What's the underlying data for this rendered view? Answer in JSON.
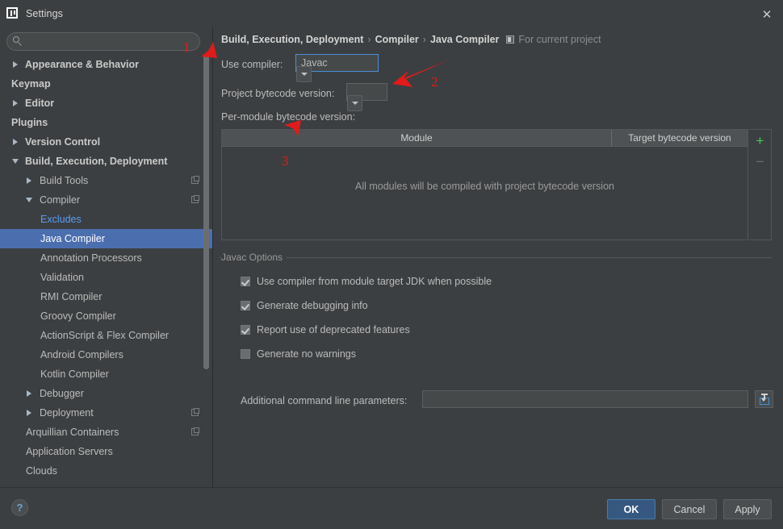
{
  "window": {
    "title": "Settings",
    "app_icon": "intellij-idea-icon",
    "close_label": "✕"
  },
  "sidebar": {
    "search": {
      "placeholder": "",
      "value": "",
      "icon": "search-icon"
    },
    "items": [
      {
        "label": "Appearance & Behavior",
        "level": 0,
        "toggle": "collapsed",
        "selected": false,
        "link": false,
        "badge": false
      },
      {
        "label": "Keymap",
        "level": 0,
        "toggle": "none",
        "selected": false,
        "link": false,
        "badge": false
      },
      {
        "label": "Editor",
        "level": 0,
        "toggle": "collapsed",
        "selected": false,
        "link": false,
        "badge": false
      },
      {
        "label": "Plugins",
        "level": 0,
        "toggle": "none",
        "selected": false,
        "link": false,
        "badge": false
      },
      {
        "label": "Version Control",
        "level": 0,
        "toggle": "collapsed",
        "selected": false,
        "link": false,
        "badge": false
      },
      {
        "label": "Build, Execution, Deployment",
        "level": 0,
        "toggle": "expanded",
        "selected": false,
        "link": false,
        "badge": false
      },
      {
        "label": "Build Tools",
        "level": 1,
        "toggle": "collapsed",
        "selected": false,
        "link": false,
        "badge": true
      },
      {
        "label": "Compiler",
        "level": 1,
        "toggle": "expanded",
        "selected": false,
        "link": false,
        "badge": true
      },
      {
        "label": "Excludes",
        "level": 2,
        "toggle": "none",
        "selected": false,
        "link": true,
        "badge": false
      },
      {
        "label": "Java Compiler",
        "level": 2,
        "toggle": "none",
        "selected": true,
        "link": false,
        "badge": false
      },
      {
        "label": "Annotation Processors",
        "level": 2,
        "toggle": "none",
        "selected": false,
        "link": false,
        "badge": false
      },
      {
        "label": "Validation",
        "level": 2,
        "toggle": "none",
        "selected": false,
        "link": false,
        "badge": false
      },
      {
        "label": "RMI Compiler",
        "level": 2,
        "toggle": "none",
        "selected": false,
        "link": false,
        "badge": false
      },
      {
        "label": "Groovy Compiler",
        "level": 2,
        "toggle": "none",
        "selected": false,
        "link": false,
        "badge": false
      },
      {
        "label": "ActionScript & Flex Compiler",
        "level": 2,
        "toggle": "none",
        "selected": false,
        "link": false,
        "badge": false
      },
      {
        "label": "Android Compilers",
        "level": 2,
        "toggle": "none",
        "selected": false,
        "link": false,
        "badge": false
      },
      {
        "label": "Kotlin Compiler",
        "level": 2,
        "toggle": "none",
        "selected": false,
        "link": false,
        "badge": false
      },
      {
        "label": "Debugger",
        "level": 1,
        "toggle": "collapsed",
        "selected": false,
        "link": false,
        "badge": false
      },
      {
        "label": "Deployment",
        "level": 1,
        "toggle": "collapsed",
        "selected": false,
        "link": false,
        "badge": true
      },
      {
        "label": "Arquillian Containers",
        "level": 1,
        "toggle": "none",
        "selected": false,
        "link": false,
        "badge": true
      },
      {
        "label": "Application Servers",
        "level": 1,
        "toggle": "none",
        "selected": false,
        "link": false,
        "badge": false
      },
      {
        "label": "Clouds",
        "level": 1,
        "toggle": "none",
        "selected": false,
        "link": false,
        "badge": false
      }
    ]
  },
  "panel": {
    "breadcrumb": {
      "crumb1": "Build, Execution, Deployment",
      "sep1": "›",
      "crumb2": "Compiler",
      "sep2": "›",
      "crumb3": "Java Compiler",
      "scope_icon": "project-scope-icon",
      "scope_note": "For current project"
    },
    "use_compiler": {
      "label": "Use compiler:",
      "value": "Javac",
      "caret_icon": "chevron-down-icon"
    },
    "project_bytecode": {
      "label": "Project bytecode version:",
      "value": "",
      "caret_icon": "chevron-down-icon"
    },
    "per_module_label": "Per-module bytecode version:",
    "module_table": {
      "columns": [
        "Module",
        "Target bytecode version"
      ],
      "rows": [],
      "empty_message": "All modules will be compiled with project bytecode version",
      "add_button": "+",
      "remove_button": "−"
    },
    "javac_options": {
      "title": "Javac Options",
      "checkboxes": [
        {
          "label": "Use compiler from module target JDK when possible",
          "checked": true
        },
        {
          "label": "Generate debugging info",
          "checked": true
        },
        {
          "label": "Report use of deprecated features",
          "checked": true
        },
        {
          "label": "Generate no warnings",
          "checked": false
        }
      ],
      "params": {
        "label": "Additional command line parameters:",
        "value": "",
        "placeholder": "",
        "button_icon": "insert-macro-icon"
      }
    }
  },
  "footer": {
    "help_label": "?",
    "ok_label": "OK",
    "cancel_label": "Cancel",
    "apply_label": "Apply"
  },
  "annotations": {
    "marker1": "1",
    "marker2": "2",
    "marker3": "3",
    "color": "#e01b1b"
  },
  "colors": {
    "background": "#3c3f41",
    "selection": "#4b6eaf",
    "link": "#589df6",
    "primary_button": "#365880",
    "add_green": "#42c95f"
  }
}
